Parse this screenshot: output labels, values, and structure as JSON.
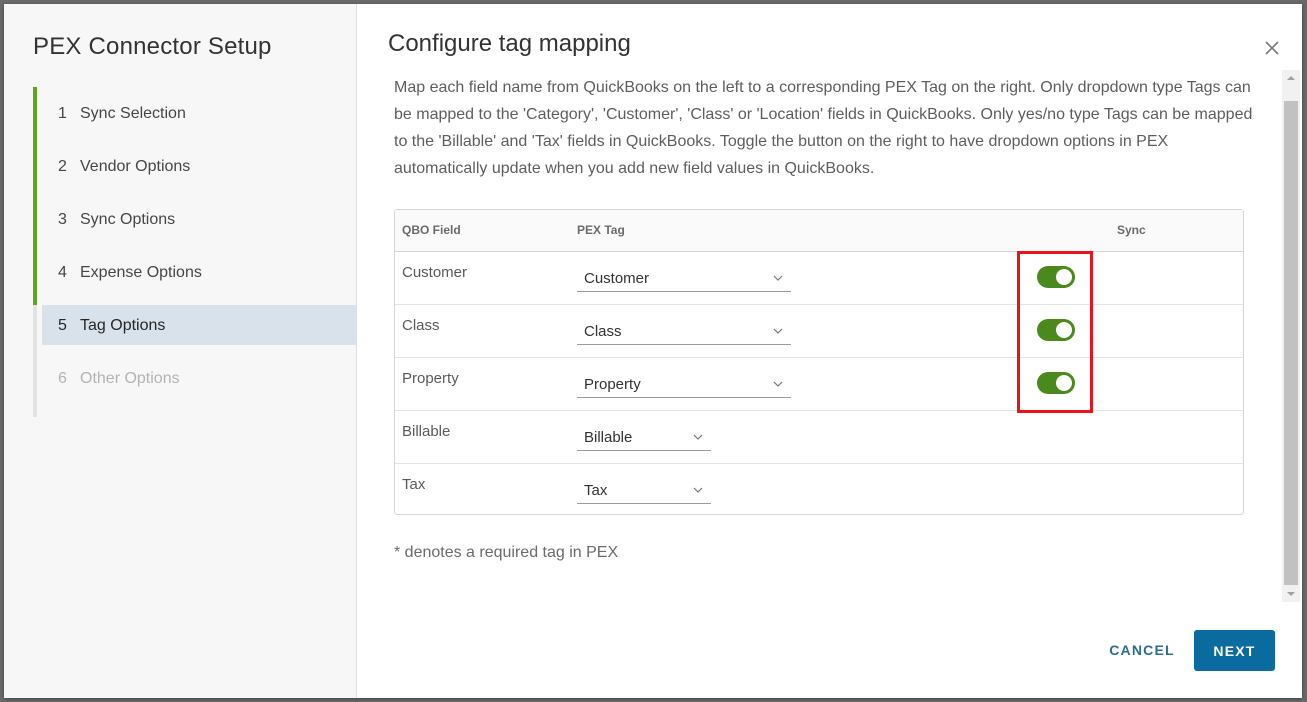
{
  "sidebar": {
    "title": "PEX Connector Setup",
    "steps": [
      {
        "num": "1",
        "label": "Sync Selection",
        "state": "complete"
      },
      {
        "num": "2",
        "label": "Vendor Options",
        "state": "complete"
      },
      {
        "num": "3",
        "label": "Sync Options",
        "state": "complete"
      },
      {
        "num": "4",
        "label": "Expense Options",
        "state": "complete"
      },
      {
        "num": "5",
        "label": "Tag Options",
        "state": "active"
      },
      {
        "num": "6",
        "label": "Other Options",
        "state": "upcoming"
      }
    ]
  },
  "main": {
    "title": "Configure tag mapping",
    "description": "Map each field name from QuickBooks on the left to a corresponding PEX Tag on the right. Only dropdown type Tags can be mapped to the 'Category', 'Customer', 'Class' or 'Location' fields in QuickBooks. Only yes/no type Tags can be mapped to the 'Billable' and 'Tax' fields in QuickBooks. Toggle the button on the right to have dropdown options in PEX automatically update when you add new field values in QuickBooks.",
    "footnote": "* denotes a required tag in PEX"
  },
  "table": {
    "headers": {
      "field": "QBO Field",
      "tag": "PEX Tag",
      "sync": "Sync"
    },
    "rows": [
      {
        "field": "Customer",
        "tag": "Customer",
        "sync": true
      },
      {
        "field": "Class",
        "tag": "Class",
        "sync": true
      },
      {
        "field": "Property",
        "tag": "Property",
        "sync": true
      },
      {
        "field": "Billable",
        "tag": "Billable",
        "sync": null
      },
      {
        "field": "Tax",
        "tag": "Tax",
        "sync": null
      }
    ]
  },
  "buttons": {
    "cancel": "CANCEL",
    "next": "NEXT"
  },
  "colors": {
    "progress_complete": "#62a420",
    "progress_upcoming": "#e2e2e2",
    "active_step_bg": "#d9e2ea",
    "toggle_on": "#4a8a1d",
    "primary_button": "#0a6c9e",
    "annotation_box": "#e8141c"
  },
  "icons": {
    "close": "close-icon",
    "dropdown": "chevron-down-icon"
  }
}
